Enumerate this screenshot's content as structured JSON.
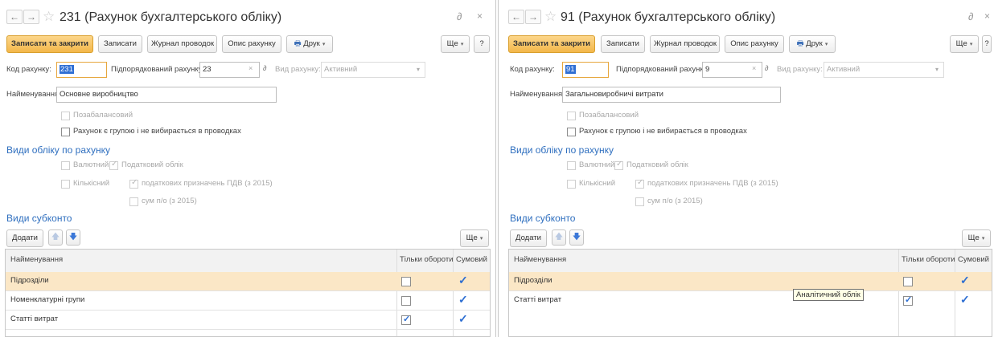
{
  "colors": {
    "accent": "#f3b74a",
    "section": "#2f6fbf",
    "selected_row": "#fbe7c6",
    "check": "#2d6ed2"
  },
  "forms": [
    {
      "title": "231 (Рахунок бухгалтерського обліку)",
      "toolbar": {
        "save_close": "Записати та закрити",
        "save": "Записати",
        "journal": "Журнал проводок",
        "description": "Опис рахунку",
        "print": "Друк",
        "more": "Ще",
        "help": "?"
      },
      "code": {
        "label": "Код рахунку:",
        "value": "231"
      },
      "parent": {
        "label": "Підпорядкований рахунку:",
        "value": "23"
      },
      "kind": {
        "label": "Вид рахунку:",
        "value": "Активний"
      },
      "name": {
        "label": "Найменування:",
        "value": "Основне виробництво"
      },
      "offbalance": "Позабалансовий",
      "group": "Рахунок є групою і не вибирається в проводках",
      "accounting_section": "Види обліку по рахунку",
      "currency": "Валютний",
      "tax": "Податковий облік",
      "quantity": "Кількісний",
      "vat": "податкових призначень ПДВ (з 2015)",
      "sum": "сум п/о (з 2015)",
      "subconto_section": "Види субконто",
      "add": "Додати",
      "more": "Ще",
      "columns": {
        "name": "Найменування",
        "turnover": "Тільки обороти",
        "sum": "Сумовий"
      },
      "rows": [
        {
          "name": "Підрозділи",
          "turnover": false,
          "sum": true
        },
        {
          "name": "Номенклатурні групи",
          "turnover": false,
          "sum": true
        },
        {
          "name": "Статті витрат",
          "turnover": true,
          "sum": true
        }
      ]
    },
    {
      "title": "91 (Рахунок бухгалтерського обліку)",
      "toolbar": {
        "save_close": "Записати та закрити",
        "save": "Записати",
        "journal": "Журнал проводок",
        "description": "Опис рахунку",
        "print": "Друк",
        "more": "Ще",
        "help": "?"
      },
      "code": {
        "label": "Код рахунку:",
        "value": "91"
      },
      "parent": {
        "label": "Підпорядкований рахунку:",
        "value": "9"
      },
      "kind": {
        "label": "Вид рахунку:",
        "value": "Активний"
      },
      "name": {
        "label": "Найменування:",
        "value": "Загальновиробничі витрати"
      },
      "offbalance": "Позабалансовий",
      "group": "Рахунок є групою і не вибирається в проводках",
      "accounting_section": "Види обліку по рахунку",
      "currency": "Валютний",
      "tax": "Податковий облік",
      "quantity": "Кількісний",
      "vat": "податкових призначень ПДВ (з 2015)",
      "sum": "сум п/о (з 2015)",
      "subconto_section": "Види субконто",
      "add": "Додати",
      "more": "Ще",
      "columns": {
        "name": "Найменування",
        "turnover": "Тільки обороти",
        "sum": "Сумовий"
      },
      "rows": [
        {
          "name": "Підрозділи",
          "turnover": false,
          "sum": true
        },
        {
          "name": "Статті витрат",
          "turnover": true,
          "sum": true
        }
      ],
      "tooltip": "Аналітичний облік"
    }
  ]
}
